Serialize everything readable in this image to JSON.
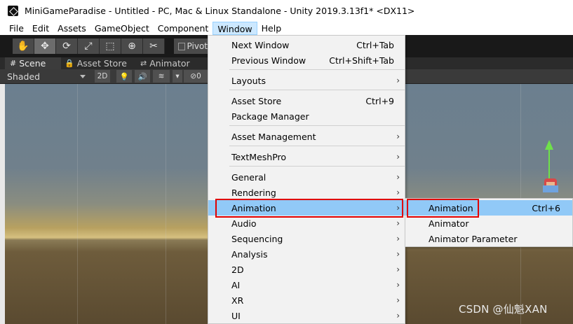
{
  "window": {
    "title": "MiniGameParadise - Untitled - PC, Mac & Linux Standalone - Unity 2019.3.13f1* <DX11>"
  },
  "menubar": [
    "File",
    "Edit",
    "Assets",
    "GameObject",
    "Component",
    "Window",
    "Help"
  ],
  "toolbar": {
    "pivot_label": "Pivot"
  },
  "tabs": [
    {
      "icon": "#",
      "label": "Scene"
    },
    {
      "icon": "🔒",
      "label": "Asset Store"
    },
    {
      "icon": "⇄",
      "label": "Animator"
    }
  ],
  "scene_toolbar": {
    "shading_mode": "Shaded",
    "mode_2d": "2D",
    "hidden_count": "0"
  },
  "window_menu": {
    "items": [
      {
        "label": "Next Window",
        "shortcut": "Ctrl+Tab"
      },
      {
        "label": "Previous Window",
        "shortcut": "Ctrl+Shift+Tab"
      },
      {
        "label": "Layouts",
        "submenu": "›"
      },
      {
        "label": "Asset Store",
        "shortcut": "Ctrl+9"
      },
      {
        "label": "Package Manager"
      },
      {
        "label": "Asset Management",
        "submenu": "›"
      },
      {
        "label": "TextMeshPro",
        "submenu": "›"
      },
      {
        "label": "General",
        "submenu": "›"
      },
      {
        "label": "Rendering",
        "submenu": "›"
      },
      {
        "label": "Animation",
        "submenu": "›"
      },
      {
        "label": "Audio",
        "submenu": "›"
      },
      {
        "label": "Sequencing",
        "submenu": "›"
      },
      {
        "label": "Analysis",
        "submenu": "›"
      },
      {
        "label": "2D",
        "submenu": "›"
      },
      {
        "label": "AI",
        "submenu": "›"
      },
      {
        "label": "XR",
        "submenu": "›"
      },
      {
        "label": "UI",
        "submenu": "›"
      }
    ]
  },
  "animation_submenu": {
    "items": [
      {
        "label": "Animation",
        "shortcut": "Ctrl+6"
      },
      {
        "label": "Animator"
      },
      {
        "label": "Animator Parameter"
      }
    ]
  },
  "watermark": "CSDN @仙魁XAN",
  "colors": {
    "highlight": "#91c9f7",
    "annotation": "#e00000",
    "gizmo_y": "#6fe14a"
  }
}
